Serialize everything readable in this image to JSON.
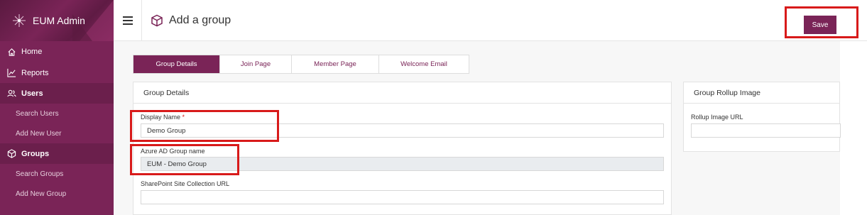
{
  "sidebar": {
    "brand": "EUM Admin",
    "items": [
      {
        "label": "Home",
        "icon": "home-icon"
      },
      {
        "label": "Reports",
        "icon": "chart-line-icon"
      },
      {
        "label": "Users",
        "icon": "users-icon"
      },
      {
        "label": "Search Users"
      },
      {
        "label": "Add New User"
      },
      {
        "label": "Groups",
        "icon": "cube-icon"
      },
      {
        "label": "Search Groups"
      },
      {
        "label": "Add New Group"
      }
    ]
  },
  "header": {
    "title": "Add a group",
    "save_label": "Save"
  },
  "tabs": [
    "Group Details",
    "Join Page",
    "Member Page",
    "Welcome Email"
  ],
  "group_details": {
    "card_title": "Group Details",
    "display_name_label": "Display Name",
    "display_name_required": "*",
    "display_name_value": "Demo Group",
    "azure_label": "Azure AD Group name",
    "azure_value": "EUM - Demo Group",
    "sharepoint_label": "SharePoint Site Collection URL",
    "sharepoint_value": ""
  },
  "rollup": {
    "card_title": "Group Rollup Image",
    "url_label": "Rollup Image URL",
    "url_value": ""
  },
  "colors": {
    "brand": "#7a2457",
    "highlight": "#d81a1a"
  }
}
